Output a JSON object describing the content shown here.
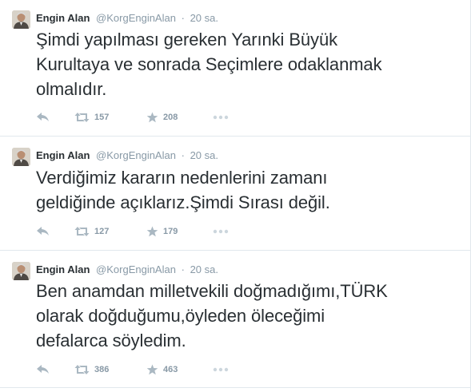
{
  "colors": {
    "text": "#292f33",
    "muted": "#8899a6",
    "icon": "#aab8c2",
    "divider": "#e1e8ed"
  },
  "tweets": [
    {
      "author": {
        "name": "Engin Alan",
        "handle": "@KorgEnginAlan"
      },
      "separator": "·",
      "time": "20 sa.",
      "text": "Şimdi yapılması gereken Yarınki Büyük\nKurultaya ve sonrada  Seçimlere odaklanmak\nolmalıdır.",
      "retweets": "157",
      "favorites": "208",
      "icons": {
        "reply": "reply-icon",
        "retweet": "retweet-icon",
        "favorite": "star-icon",
        "more": "more-dots-icon"
      }
    },
    {
      "author": {
        "name": "Engin Alan",
        "handle": "@KorgEnginAlan"
      },
      "separator": "·",
      "time": "20 sa.",
      "text": "Verdiğimiz kararın nedenlerini zamanı\ngeldiğinde açıklarız.Şimdi Sırası değil.",
      "retweets": "127",
      "favorites": "179",
      "icons": {
        "reply": "reply-icon",
        "retweet": "retweet-icon",
        "favorite": "star-icon",
        "more": "more-dots-icon"
      }
    },
    {
      "author": {
        "name": "Engin Alan",
        "handle": "@KorgEnginAlan"
      },
      "separator": "·",
      "time": "20 sa.",
      "text": "Ben anamdan milletvekili doğmadığımı,TÜRK\nolarak doğduğumu,öyleden öleceğimi\ndefalarca söyledim.",
      "retweets": "386",
      "favorites": "463",
      "icons": {
        "reply": "reply-icon",
        "retweet": "retweet-icon",
        "favorite": "star-icon",
        "more": "more-dots-icon"
      }
    }
  ]
}
